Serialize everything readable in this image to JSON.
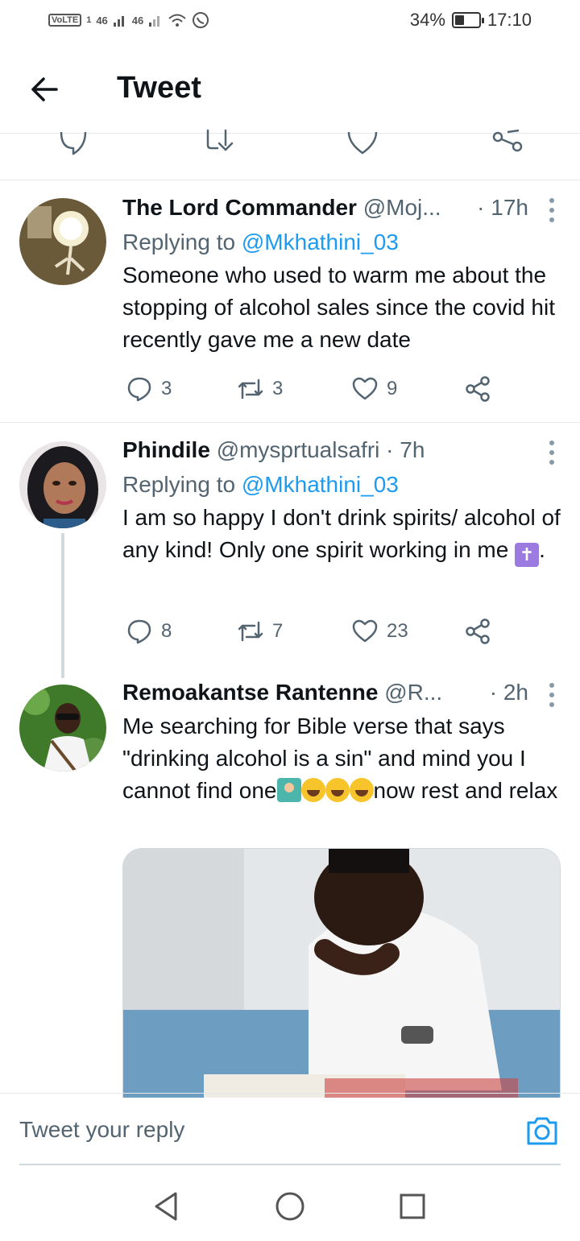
{
  "status_bar": {
    "network_badge": "VoLTE",
    "network_sim": "1",
    "signal_1": "46",
    "signal_2": "46",
    "battery": "34%",
    "time": "17:10"
  },
  "header": {
    "title": "Tweet"
  },
  "tweets": [
    {
      "name": "The Lord Commander",
      "handle": "@Moj...",
      "time": "· 17h",
      "reply_prefix": "Replying to ",
      "reply_mention": "@Mkhathini_03",
      "text": "Someone who used to warm me about the stopping of alcohol sales since the covid hit recently gave me a new date",
      "replies": "3",
      "retweets": "3",
      "likes": "9"
    },
    {
      "name": "Phindile",
      "handle": "@mysprtualsafri",
      "time": "· 7h",
      "reply_prefix": "Replying to ",
      "reply_mention": "@Mkhathini_03",
      "text": "I am so happy I don't drink spirits/ alcohol of any kind! Only one spirit working in me",
      "text_end": ".",
      "emoji": "✝",
      "replies": "8",
      "retweets": "7",
      "likes": "23"
    },
    {
      "name": "Remoakantse Rantenne",
      "handle": "@R...",
      "time": "· 2h",
      "text_part1": "Me searching for Bible verse that says \"drinking alcohol is a sin\" and mind you I cannot find one",
      "text_part2": "now rest and relax"
    }
  ],
  "reply_bar": {
    "placeholder": "Tweet your reply"
  },
  "colors": {
    "link": "#1d9bf0",
    "muted": "#536471",
    "text": "#0f1419",
    "divider": "#e6e9ec"
  },
  "icons": [
    "back-arrow-icon",
    "reply-icon",
    "retweet-icon",
    "like-icon",
    "share-icon",
    "more-icon",
    "camera-icon",
    "nav-back-icon",
    "nav-home-icon",
    "nav-recents-icon"
  ]
}
